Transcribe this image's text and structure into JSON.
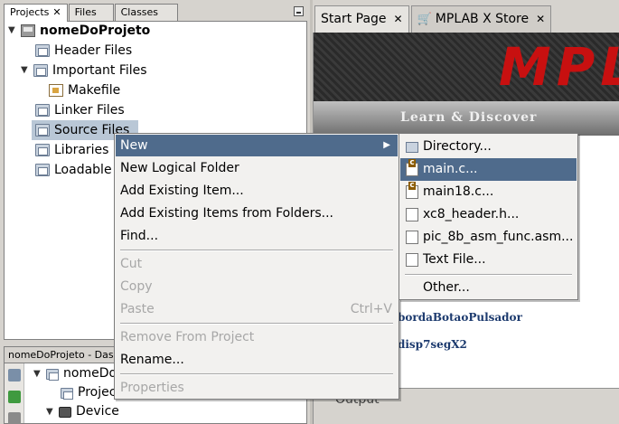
{
  "project_tabs": {
    "projects": "Projects",
    "files": "Files",
    "classes": "Classes",
    "close_glyph": "✕"
  },
  "project_tree": {
    "root": "nomeDoProjeto",
    "items": [
      {
        "label": "Header Files"
      },
      {
        "label": "Important Files"
      },
      {
        "label": "Makefile"
      },
      {
        "label": "Linker Files"
      },
      {
        "label": "Source Files"
      },
      {
        "label": "Libraries"
      },
      {
        "label": "Loadable"
      }
    ]
  },
  "dashboard": {
    "title": "nomeDoProjeto - Das",
    "items": [
      {
        "label": "nomeDo"
      },
      {
        "label": "Projec"
      },
      {
        "label": "Device"
      }
    ]
  },
  "editor_tabs": [
    {
      "label": "Start Page"
    },
    {
      "label": "MPLAB X Store"
    }
  ],
  "start_page": {
    "banner_logo": "MPL",
    "learn_discover": "Learn & Discover",
    "links": [
      "-bordaBotaoPulsador",
      "-disp7segX2"
    ],
    "output_label": "Output"
  },
  "context_menu": {
    "items": [
      {
        "label": "New",
        "highlighted": true,
        "submenu": true
      },
      {
        "label": "New Logical Folder"
      },
      {
        "label": "Add Existing Item..."
      },
      {
        "label": "Add Existing Items from Folders..."
      },
      {
        "label": "Find..."
      },
      {
        "label": "Cut",
        "disabled": true
      },
      {
        "label": "Copy",
        "disabled": true
      },
      {
        "label": "Paste",
        "disabled": true,
        "accelerator": "Ctrl+V"
      },
      {
        "label": "Remove From Project",
        "disabled": true
      },
      {
        "label": "Rename..."
      },
      {
        "label": "Properties",
        "disabled": true
      }
    ],
    "submenu_arrow": "▶"
  },
  "new_submenu": {
    "items": [
      {
        "label": "Directory..."
      },
      {
        "label": "main.c...",
        "highlighted": true
      },
      {
        "label": "main18.c..."
      },
      {
        "label": "xc8_header.h..."
      },
      {
        "label": "pic_8b_asm_func.asm..."
      },
      {
        "label": "Text File..."
      },
      {
        "label": "Other..."
      }
    ]
  },
  "colors": {
    "highlight": "#4f6b8c",
    "selection": "#b9c7d6",
    "logo_red": "#c81010"
  }
}
